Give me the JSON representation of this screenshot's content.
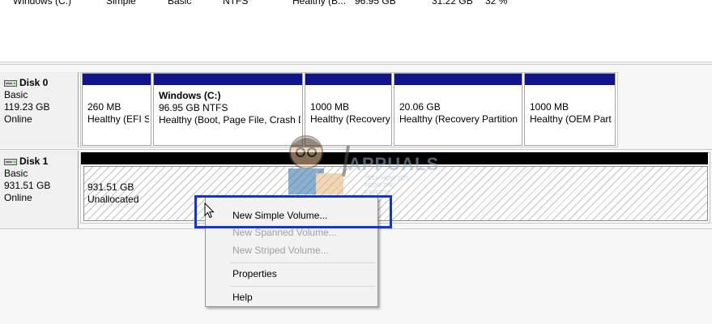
{
  "volume_row": {
    "name": "Windows (C:)",
    "layout": "Simple",
    "type": "Basic",
    "fs": "NTFS",
    "status": "Healthy (B...",
    "capacity": "96.95 GB",
    "free": "31.22 GB",
    "pct": "32 %"
  },
  "disks": [
    {
      "name": "Disk 0",
      "type": "Basic",
      "size": "119.23 GB",
      "state": "Online",
      "partitions": [
        {
          "title": "",
          "size": "260 MB",
          "status": "Healthy (EFI S"
        },
        {
          "title": "Windows  (C:)",
          "size": "96.95 GB NTFS",
          "status": "Healthy (Boot, Page File, Crash D"
        },
        {
          "title": "",
          "size": "1000 MB",
          "status": "Healthy (Recovery"
        },
        {
          "title": "",
          "size": "20.06 GB",
          "status": "Healthy (Recovery Partition"
        },
        {
          "title": "",
          "size": "1000 MB",
          "status": "Healthy (OEM Part"
        }
      ]
    },
    {
      "name": "Disk 1",
      "type": "Basic",
      "size": "931.51 GB",
      "state": "Online",
      "unallocated": {
        "size": "931.51 GB",
        "label": "Unallocated"
      }
    }
  ],
  "context_menu": {
    "items": [
      {
        "label": "New Simple Volume...",
        "enabled": true
      },
      {
        "label": "New Spanned Volume...",
        "enabled": false
      },
      {
        "label": "New Striped Volume...",
        "enabled": false
      },
      {
        "label": "Properties",
        "enabled": true
      },
      {
        "label": "Help",
        "enabled": true
      }
    ]
  },
  "watermark": {
    "brand": "APPUALS",
    "tagline": "TECH HOW-TO'S FROM THE EXPERTS"
  },
  "colors": {
    "partition_bar": "#11158c",
    "unallocated_bar": "#000000",
    "highlight": "#1632d9"
  }
}
